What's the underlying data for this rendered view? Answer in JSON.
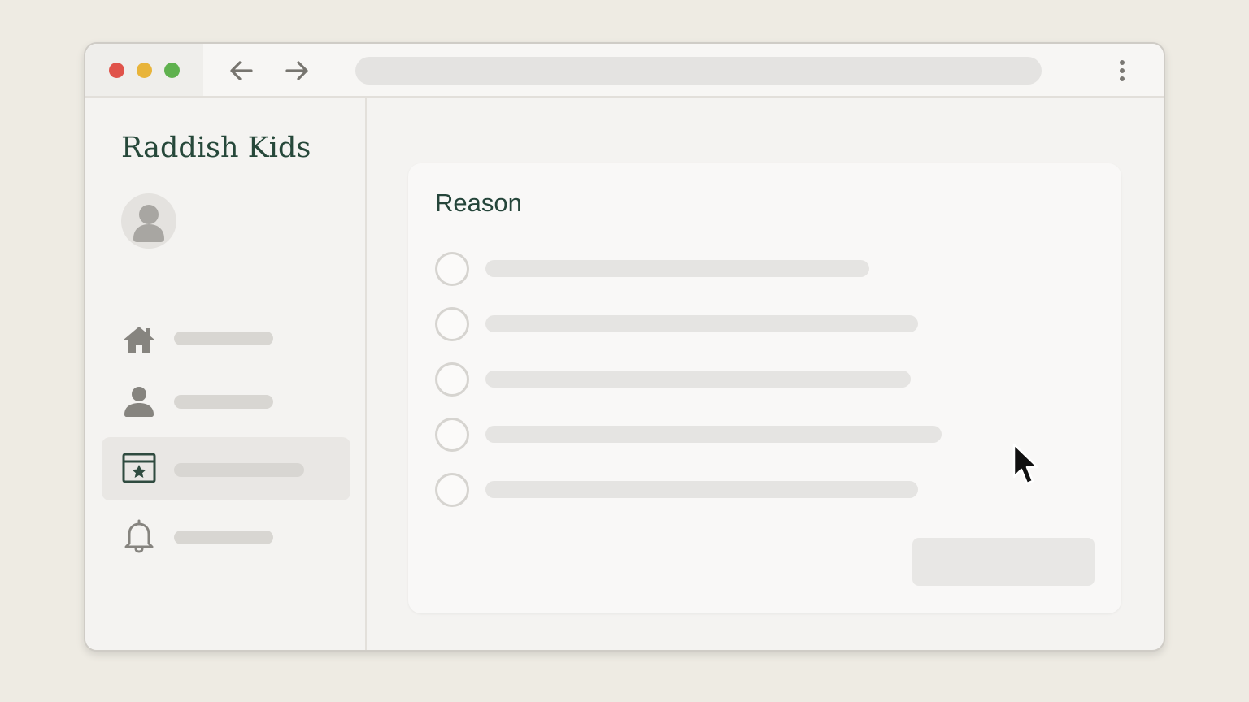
{
  "window": {
    "traffic_lights": [
      "close",
      "minimize",
      "maximize"
    ],
    "nav": {
      "back_icon": "arrow-left-icon",
      "forward_icon": "arrow-right-icon"
    },
    "address_bar": {
      "value": ""
    },
    "menu_icon": "kebab-menu-icon"
  },
  "sidebar": {
    "brand": "Raddish Kids",
    "avatar_icon": "user-avatar-icon",
    "items": [
      {
        "icon": "home-icon",
        "label": "",
        "active": false
      },
      {
        "icon": "person-icon",
        "label": "",
        "active": false
      },
      {
        "icon": "calendar-star-icon",
        "label": "",
        "active": true
      },
      {
        "icon": "bell-icon",
        "label": "",
        "active": false
      }
    ]
  },
  "main": {
    "card": {
      "title": "Reason",
      "options": [
        {
          "label": "",
          "selected": false
        },
        {
          "label": "",
          "selected": false
        },
        {
          "label": "",
          "selected": false
        },
        {
          "label": "",
          "selected": false
        },
        {
          "label": "",
          "selected": false
        }
      ],
      "submit_label": ""
    }
  },
  "colors": {
    "brand_text": "#26483a",
    "page_background": "#eeebe3",
    "close": "#e0534a",
    "minimize": "#e8b43a",
    "maximize": "#5fb14e"
  }
}
